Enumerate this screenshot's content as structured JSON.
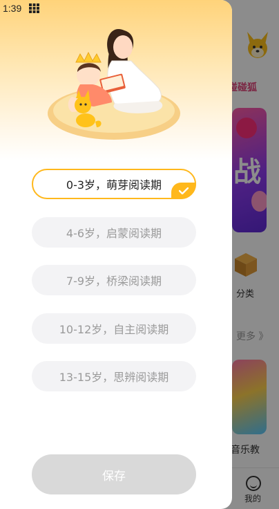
{
  "status_bar": {
    "time": "1:39"
  },
  "drawer": {
    "options": [
      {
        "label": "0-3岁，萌芽阅读期",
        "selected": true
      },
      {
        "label": "4-6岁，启蒙阅读期",
        "selected": false
      },
      {
        "label": "7-9岁，桥梁阅读期",
        "selected": false
      },
      {
        "label": "10-12岁，自主阅读期",
        "selected": false
      },
      {
        "label": "13-15岁，思辨阅读期",
        "selected": false
      }
    ],
    "save_label": "保存"
  },
  "background_app": {
    "brand_text": "碰碰狐",
    "banner_text": "战",
    "category_label": "分类",
    "more_label": "更多 》",
    "music_label": "音乐教",
    "tab_label": "我的"
  },
  "colors": {
    "accent": "#ffb81c",
    "header_gradient_top": "#ffd37a",
    "option_bg": "#f3f3f5",
    "save_disabled": "#d9d9d9"
  }
}
